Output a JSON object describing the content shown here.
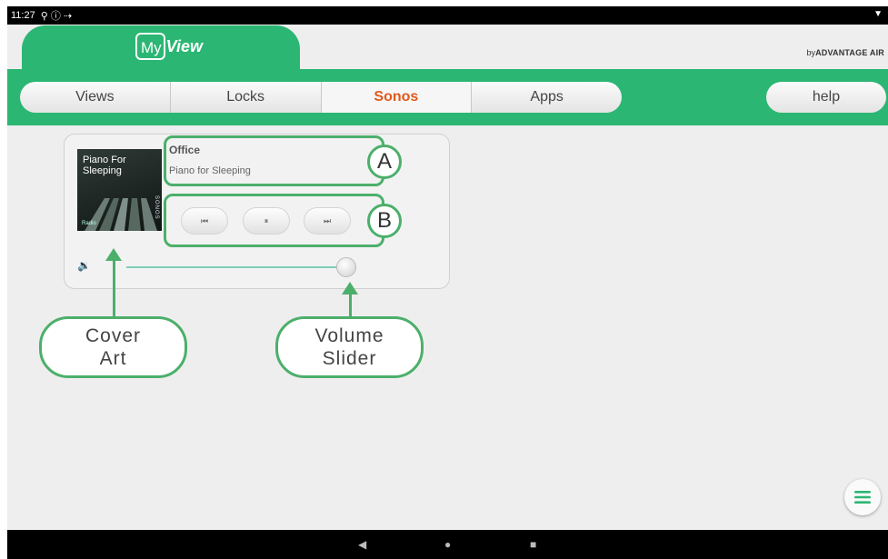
{
  "statusbar": {
    "time": "11:27",
    "icons": "⚲ ⓘ ⇢"
  },
  "header": {
    "logo_my": "My",
    "logo_view": "View",
    "byline_prefix": "by",
    "byline_brand": "ADVANTAGE AIR"
  },
  "nav": {
    "tabs": [
      {
        "label": "Views"
      },
      {
        "label": "Locks"
      },
      {
        "label": "Sonos",
        "active": true
      },
      {
        "label": "Apps"
      }
    ],
    "help_label": "help"
  },
  "player": {
    "cover_title": "Piano For Sleeping",
    "cover_tag": "Radio",
    "cover_brand": "SONOS",
    "room": "Office",
    "track": "Piano for Sleeping",
    "controls": {
      "prev": "⏮",
      "pause": "⏸",
      "next": "⏭"
    },
    "volume_level": 1.0,
    "volume_icon": "speaker-icon"
  },
  "annotations": {
    "a": "A",
    "b": "B",
    "cover_art_line1": "Cover",
    "cover_art_line2": "Art",
    "volume_line1": "Volume",
    "volume_line2": "Slider"
  },
  "colors": {
    "brand_green": "#2bb673",
    "active_tab": "#e05a1c",
    "annotation_green": "#4caf6b"
  }
}
